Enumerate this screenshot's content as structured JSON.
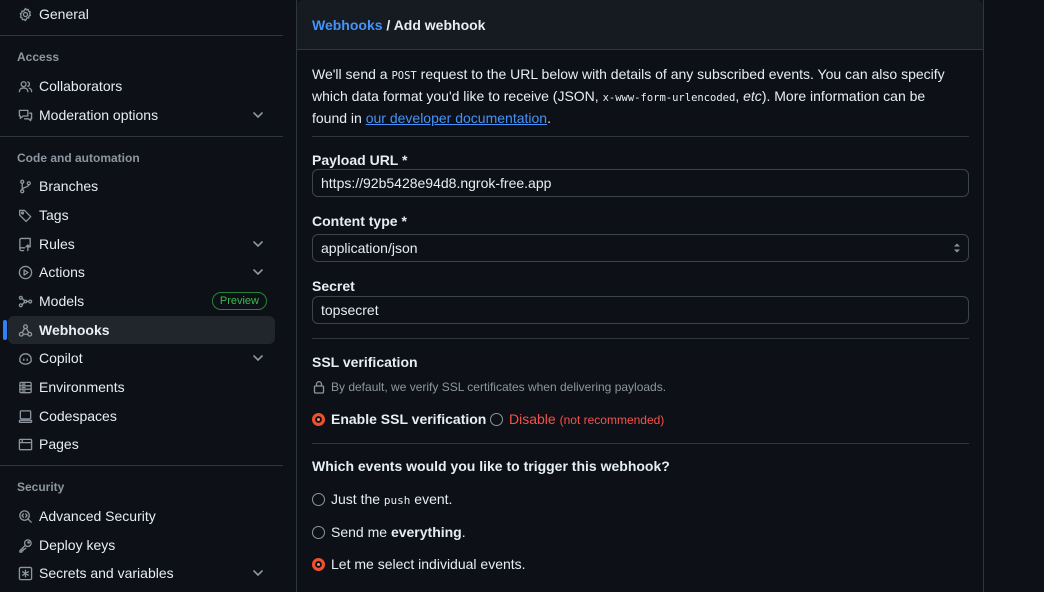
{
  "sidebar": {
    "general": "General",
    "sections": {
      "access": "Access",
      "code_automation": "Code and automation",
      "security": "Security"
    },
    "items": {
      "collaborators": "Collaborators",
      "moderation": "Moderation options",
      "branches": "Branches",
      "tags": "Tags",
      "rules": "Rules",
      "actions": "Actions",
      "models": "Models",
      "models_badge": "Preview",
      "webhooks": "Webhooks",
      "copilot": "Copilot",
      "environments": "Environments",
      "codespaces": "Codespaces",
      "pages": "Pages",
      "advanced_security": "Advanced Security",
      "deploy_keys": "Deploy keys",
      "secrets": "Secrets and variables"
    }
  },
  "header": {
    "crumb_link": "Webhooks",
    "crumb_sep": " / ",
    "crumb_current": "Add webhook"
  },
  "intro": {
    "p1": "We'll send a ",
    "code1": "POST",
    "p2": " request to the URL below with details of any subscribed events. You can also specify which data format you'd like to receive (JSON, ",
    "code2": "x-www-form-urlencoded",
    "p3": ", ",
    "etc": "etc",
    "p4": "). More information can be found in ",
    "link": "our developer documentation",
    "p5": "."
  },
  "form": {
    "payload_label": "Payload URL *",
    "payload_value": "https://92b5428e94d8.ngrok-free.app",
    "content_label": "Content type *",
    "content_value": "application/json",
    "secret_label": "Secret",
    "secret_value": "topsecret",
    "ssl_label": "SSL verification",
    "ssl_note": "By default, we verify SSL certificates when delivering payloads.",
    "ssl_enable": "Enable SSL verification",
    "ssl_disable": "Disable",
    "ssl_disable_note": "(not recommended)",
    "events_label": "Which events would you like to trigger this webhook?",
    "ev_push_pre": "Just the ",
    "ev_push_code": "push",
    "ev_push_post": " event.",
    "ev_all_pre": "Send me ",
    "ev_all_bold": "everything",
    "ev_all_post": ".",
    "ev_select": "Let me select individual events."
  },
  "colors": {
    "accent": "#4493f8",
    "active_indicator": "#2f81f7",
    "radio_checked": "#f0502a",
    "danger": "#f85149",
    "badge_green": "#3fb950"
  }
}
